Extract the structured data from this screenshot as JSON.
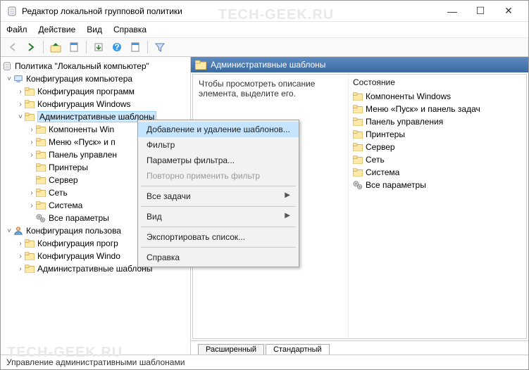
{
  "title": "Редактор локальной групповой политики",
  "menubar": {
    "file": "Файл",
    "action": "Действие",
    "view": "Вид",
    "help": "Справка"
  },
  "tree": {
    "root": "Политика \"Локальный компьютер\"",
    "compConfig": "Конфигурация компьютера",
    "confProg": "Конфигурация программ",
    "confWin": "Конфигурация Windows",
    "adminT": "Административные шаблоны",
    "compWin": "Компоненты Win",
    "menuStart": "Меню «Пуск» и п",
    "panel": "Панель управлен",
    "printers": "Принтеры",
    "server": "Сервер",
    "net": "Сеть",
    "system": "Система",
    "allParams": "Все параметры",
    "userConfig": "Конфигурация пользова",
    "confProgU": "Конфигурация прогр",
    "confWinU": "Конфигурация Windo",
    "adminTU": "Административные шаблоны"
  },
  "right": {
    "header": "Административные шаблоны",
    "desc1": "Чтобы просмотреть описание элемента, выделите его.",
    "stateHdr": "Состояние",
    "items": {
      "i0": "Компоненты Windows",
      "i1": "Меню «Пуск» и панель задач",
      "i2": "Панель управления",
      "i3": "Принтеры",
      "i4": "Сервер",
      "i5": "Сеть",
      "i6": "Система",
      "i7": "Все параметры"
    }
  },
  "ctx": {
    "addRemove": "Добавление и удаление шаблонов...",
    "filter": "Фильтр",
    "filterParams": "Параметры фильтра...",
    "reapply": "Повторно применить фильтр",
    "allTasks": "Все задачи",
    "view": "Вид",
    "export": "Экспортировать список...",
    "help": "Справка"
  },
  "tabs": {
    "ext": "Расширенный",
    "std": "Стандартный"
  },
  "status": "Управление административными шаблонами",
  "watermark": "TECH-GEEK.RU"
}
